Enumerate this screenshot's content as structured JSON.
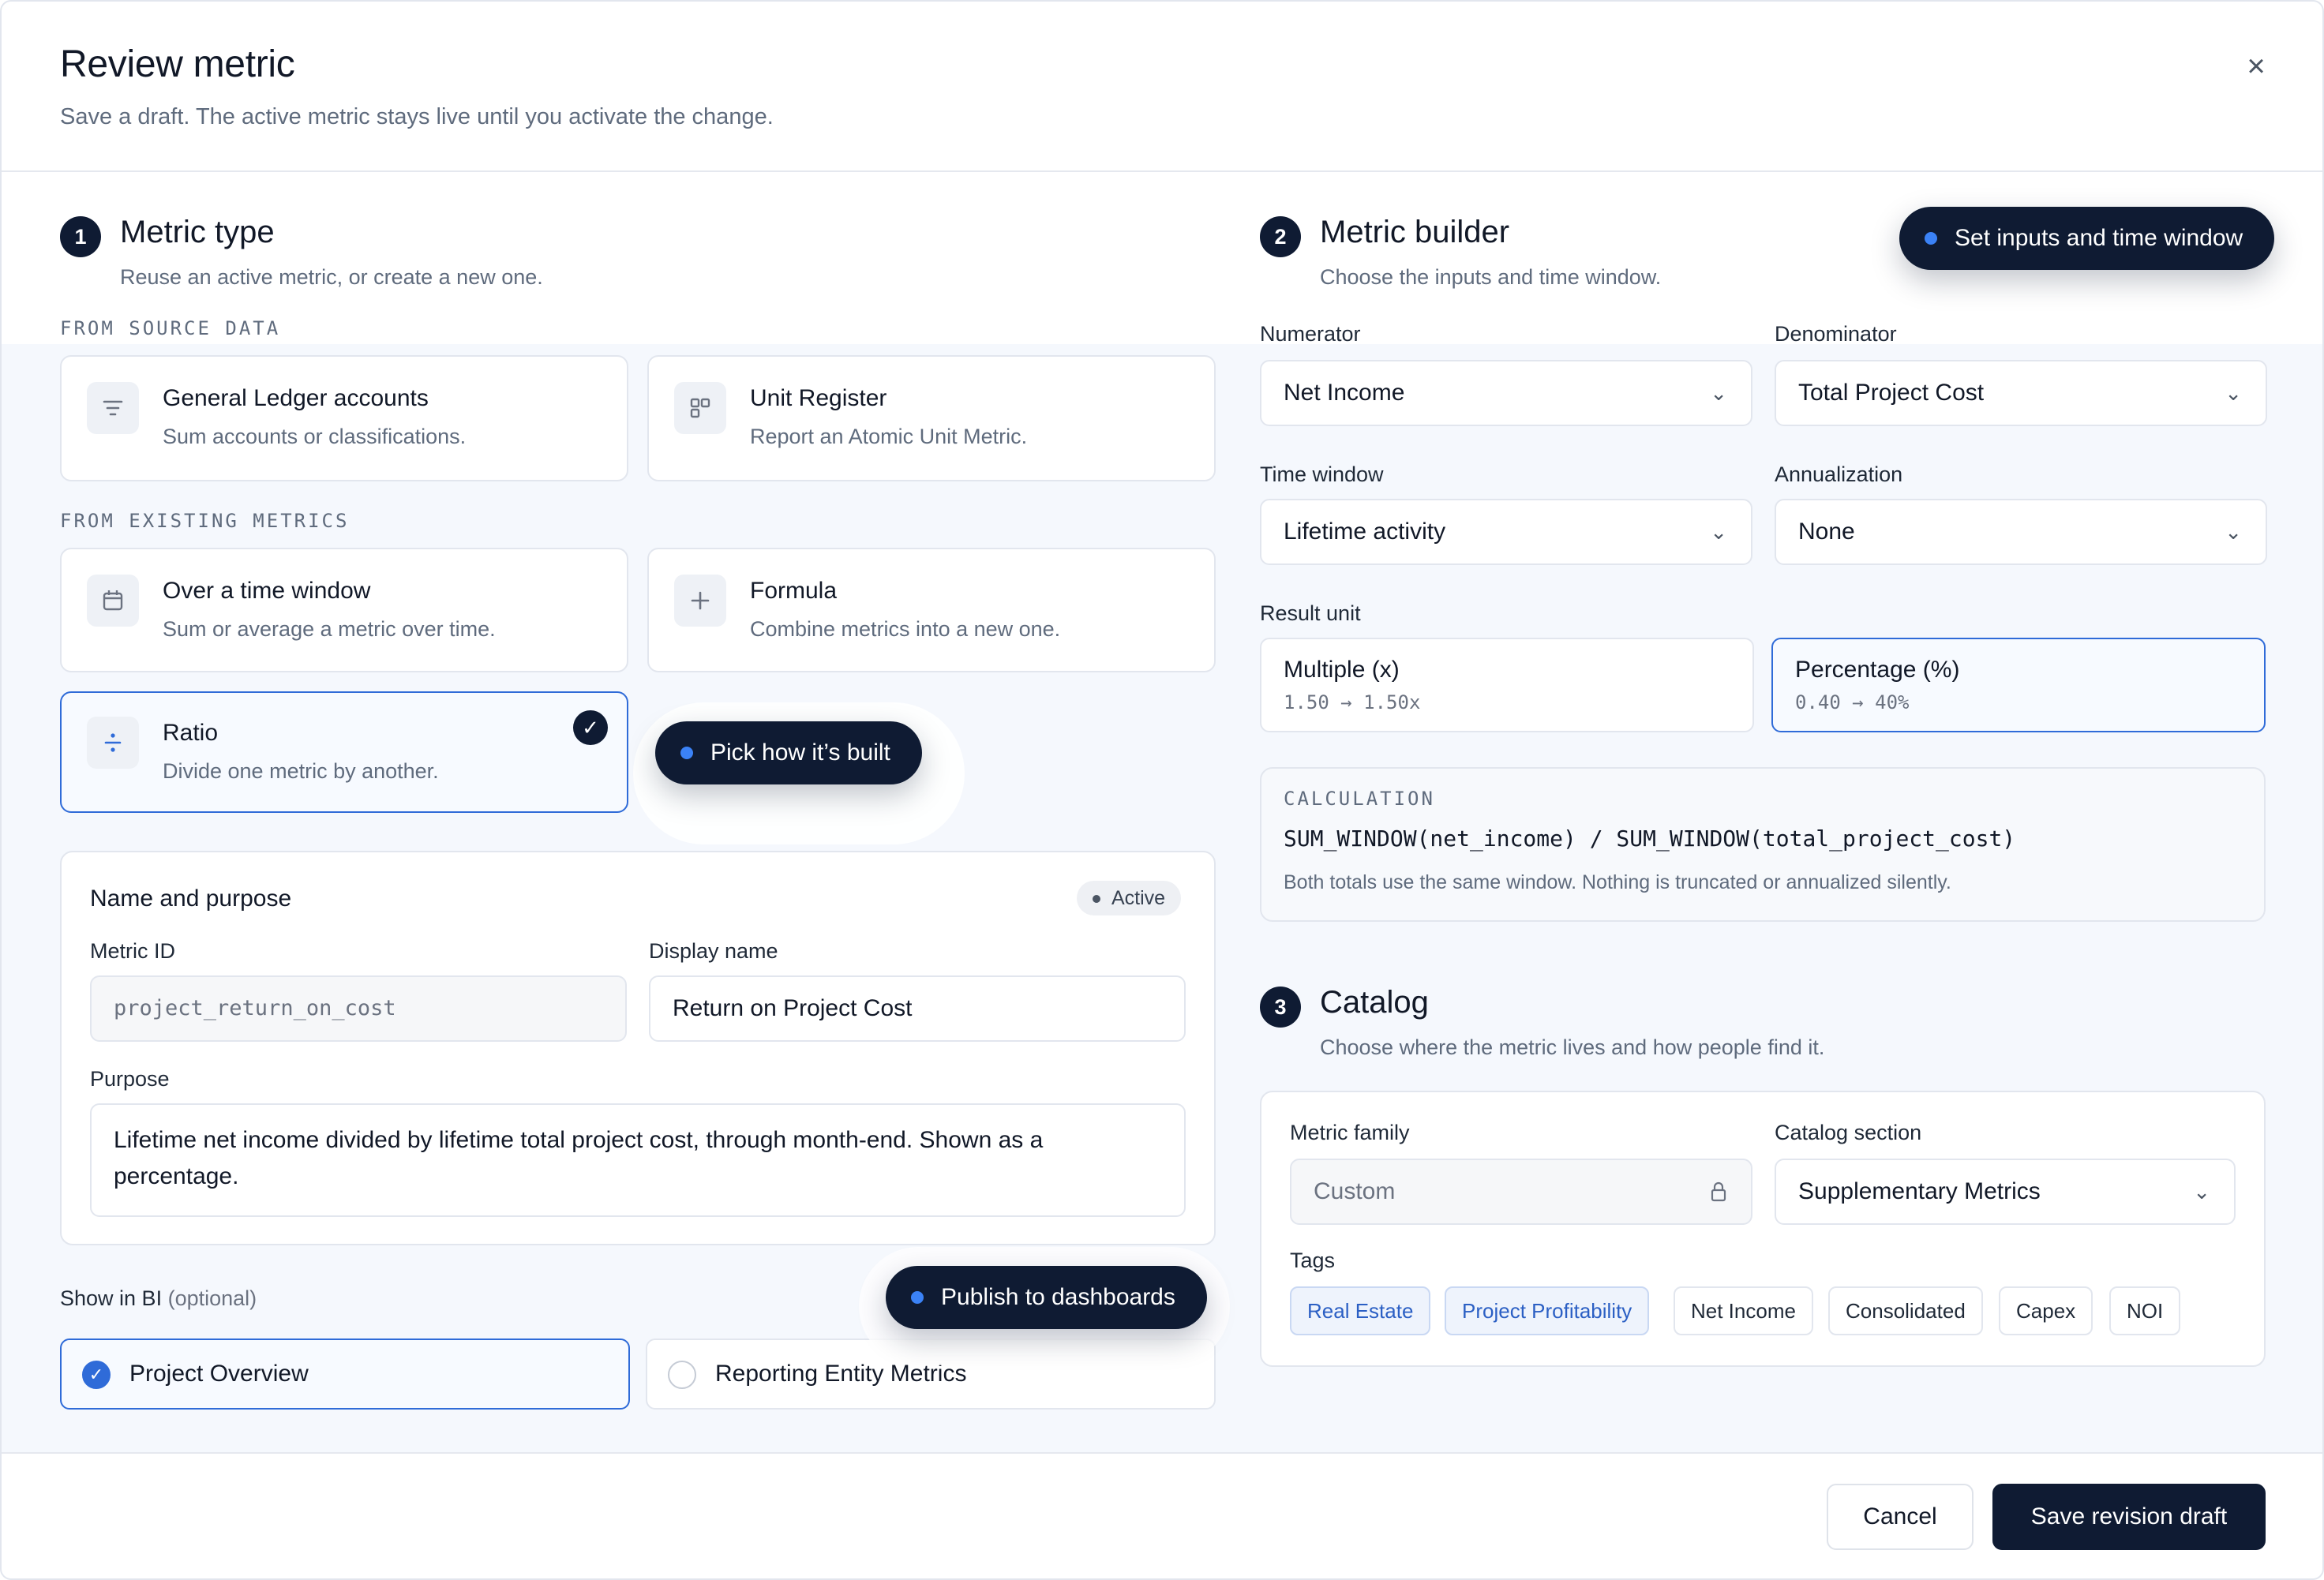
{
  "dialog": {
    "title": "Review metric",
    "subtitle": "Save a draft. The active metric stays live until you activate the change.",
    "close_icon": "×"
  },
  "metric_type": {
    "step": "1",
    "title": "Metric type",
    "subtitle": "Reuse an active metric, or create a new one.",
    "group_source": "FROM SOURCE DATA",
    "group_existing": "FROM EXISTING METRICS",
    "options": [
      {
        "title": "General Ledger accounts",
        "desc": "Sum accounts or classifications.",
        "icon": "filter-icon"
      },
      {
        "title": "Unit Register",
        "desc": "Report an Atomic Unit Metric.",
        "icon": "grid-icon"
      },
      {
        "title": "Over a time window",
        "desc": "Sum or average a metric over time.",
        "icon": "calendar-icon"
      },
      {
        "title": "Formula",
        "desc": "Combine metrics into a new one.",
        "icon": "plus-icon"
      },
      {
        "title": "Ratio",
        "desc": "Divide one metric by another.",
        "icon": "divide-icon",
        "selected": true
      }
    ],
    "hint": "Pick how it’s built"
  },
  "name_purpose": {
    "title": "Name and purpose",
    "status": "Active",
    "metric_id_label": "Metric ID",
    "metric_id_value": "project_return_on_cost",
    "display_name_label": "Display name",
    "display_name_value": "Return on Project Cost",
    "purpose_label": "Purpose",
    "purpose_value": "Lifetime net income divided by lifetime total project cost, through month-end. Shown as a percentage."
  },
  "bi": {
    "label": "Show in BI",
    "optional": "(optional)",
    "hint": "Publish to dashboards",
    "options": [
      {
        "label": "Project Overview",
        "checked": true
      },
      {
        "label": "Reporting Entity Metrics",
        "checked": false
      }
    ]
  },
  "builder": {
    "step": "2",
    "title": "Metric builder",
    "subtitle": "Choose the inputs and time window.",
    "hint": "Set inputs and time window",
    "numerator_label": "Numerator",
    "numerator_value": "Net Income",
    "denominator_label": "Denominator",
    "denominator_value": "Total Project Cost",
    "time_window_label": "Time window",
    "time_window_value": "Lifetime activity",
    "annualization_label": "Annualization",
    "annualization_value": "None",
    "result_unit_label": "Result unit",
    "units": [
      {
        "title": "Multiple (x)",
        "example": "1.50 → 1.50x",
        "selected": false
      },
      {
        "title": "Percentage (%)",
        "example": "0.40 → 40%",
        "selected": true
      }
    ],
    "calc_label": "CALCULATION",
    "calc_formula": "SUM_WINDOW(net_income) / SUM_WINDOW(total_project_cost)",
    "calc_note": "Both totals use the same window. Nothing is truncated or annualized silently."
  },
  "catalog": {
    "step": "3",
    "title": "Catalog",
    "subtitle": "Choose where the metric lives and how people find it.",
    "family_label": "Metric family",
    "family_value": "Custom",
    "section_label": "Catalog section",
    "section_value": "Supplementary Metrics",
    "tags_label": "Tags",
    "tags": [
      {
        "label": "Real Estate",
        "on": true
      },
      {
        "label": "Project Profitability",
        "on": true
      },
      {
        "label": "Net Income",
        "on": false
      },
      {
        "label": "Consolidated",
        "on": false
      },
      {
        "label": "Capex",
        "on": false
      },
      {
        "label": "NOI",
        "on": false
      }
    ]
  },
  "footer": {
    "cancel": "Cancel",
    "save": "Save revision draft"
  },
  "colors": {
    "primary_dark": "#0f1b33",
    "accent_blue": "#2f6bd8",
    "hint_dot": "#3b82f6"
  }
}
